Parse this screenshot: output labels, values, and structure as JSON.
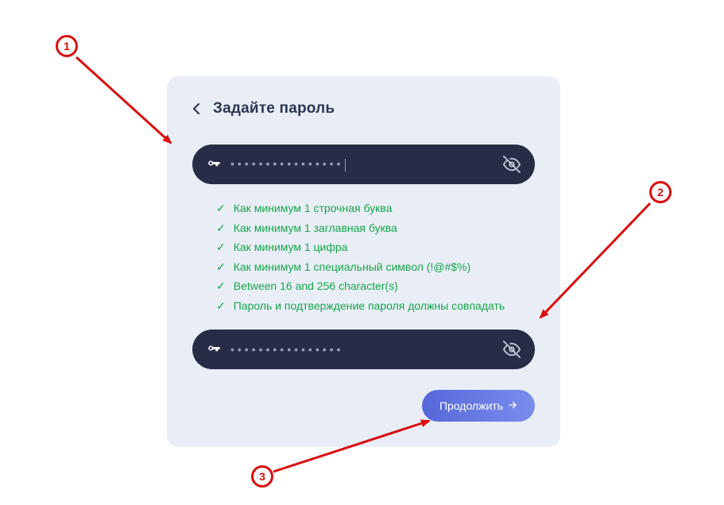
{
  "header": {
    "title": "Задайте пароль"
  },
  "password": {
    "mask": "••••••••••••••••"
  },
  "confirm_password": {
    "mask": "••••••••••••••••"
  },
  "rules": [
    "Как минимум 1 строчная буква",
    "Как минимум 1 заглавная буква",
    "Как минимум 1 цифра",
    "Как минимум 1 специальный символ (!@#$%)",
    "Between 16 and 256 character(s)",
    "Пароль и подтверждение пароля должны совпадать"
  ],
  "actions": {
    "continue": "Продолжить"
  },
  "annotations": {
    "b1": "1",
    "b2": "2",
    "b3": "3"
  },
  "colors": {
    "card_bg": "#e9eef6",
    "input_bg": "#272d47",
    "title": "#2a3653",
    "rule_ok": "#17a54b",
    "button_grad_start": "#5668d9",
    "button_grad_end": "#7a8ded",
    "annotation": "#d90e0e"
  }
}
